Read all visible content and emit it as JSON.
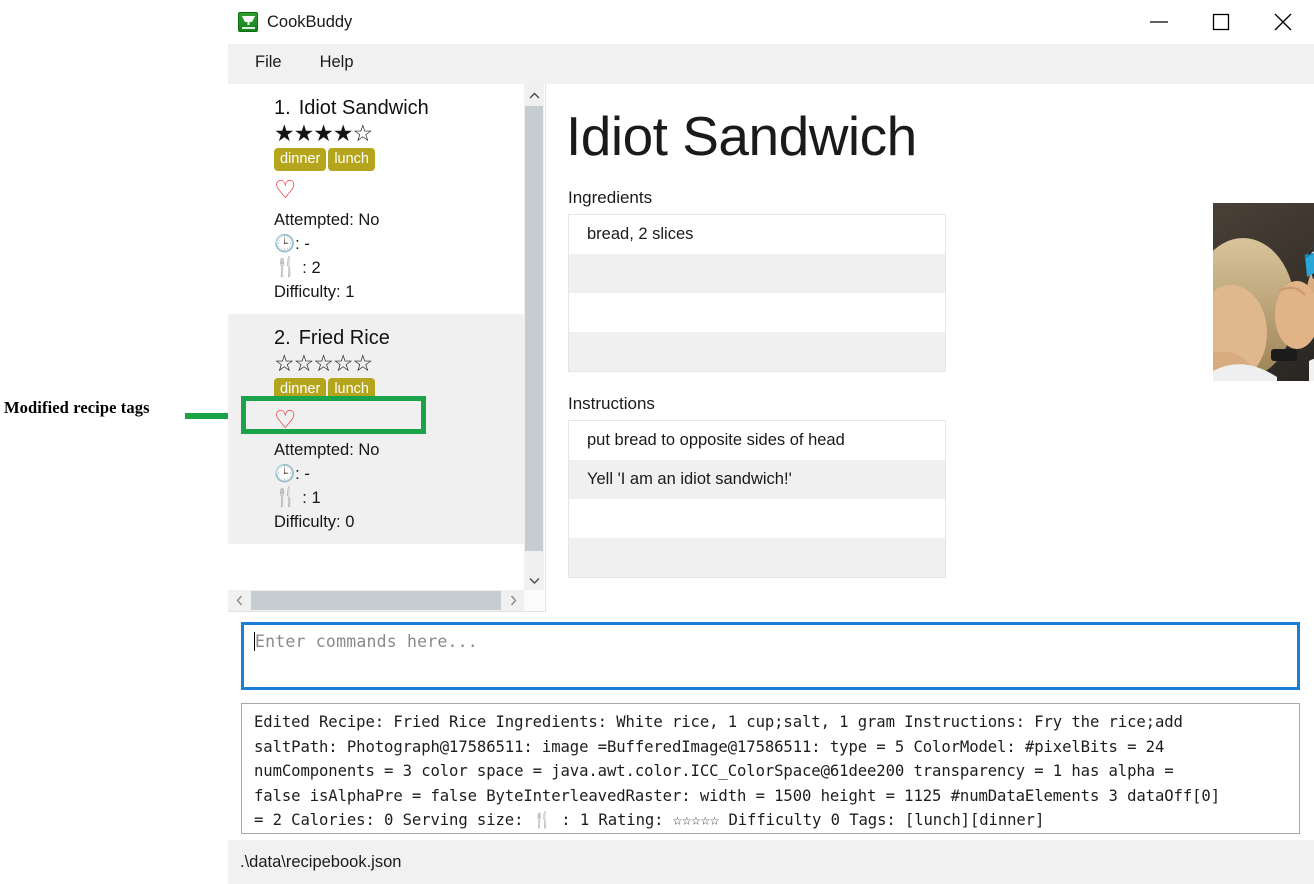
{
  "window": {
    "title": "CookBuddy",
    "icon": "cookbook-icon",
    "controls": {
      "minimize": "minimize-icon",
      "maximize": "maximize-icon",
      "close": "close-icon"
    }
  },
  "menubar": {
    "items": [
      {
        "label": "File"
      },
      {
        "label": "Help"
      }
    ]
  },
  "annotation": {
    "label": "Modified recipe tags",
    "color": "#1aa34a"
  },
  "recipe_list": {
    "items": [
      {
        "number": "1.",
        "name": "Idiot Sandwich",
        "stars": "★★★★☆",
        "rating": 4,
        "tags": [
          "dinner",
          "lunch"
        ],
        "favorite": "♡",
        "attempted_label": "Attempted: No",
        "time_icon": "clock-icon",
        "time_value": "-",
        "serving_icon": "cutlery-icon",
        "serving_value": "2",
        "difficulty_label": "Difficulty: 1"
      },
      {
        "number": "2.",
        "name": "Fried Rice",
        "stars": "☆☆☆☆☆",
        "rating": 0,
        "tags": [
          "dinner",
          "lunch"
        ],
        "favorite": "♡",
        "attempted_label": "Attempted: No",
        "time_icon": "clock-icon",
        "time_value": "-",
        "serving_icon": "cutlery-icon",
        "serving_value": "1",
        "difficulty_label": "Difficulty: 0"
      }
    ]
  },
  "detail": {
    "title": "Idiot Sandwich",
    "ingredients_label": "Ingredients",
    "ingredients": [
      "bread, 2 slices",
      "",
      "",
      ""
    ],
    "instructions_label": "Instructions",
    "instructions": [
      "put bread to opposite sides of head",
      "Yell 'I am an idiot sandwich!'",
      "",
      ""
    ],
    "photo_alt": "recipe-photo"
  },
  "command": {
    "value": "",
    "placeholder": "Enter commands here..."
  },
  "console": {
    "lines": [
      "Edited Recipe: Fried Rice Ingredients: White rice, 1 cup;salt, 1 gram Instructions: Fry the rice;add",
      "saltPath: Photograph@17586511: image =BufferedImage@17586511: type = 5 ColorModel: #pixelBits = 24",
      "numComponents = 3 color space = java.awt.color.ICC_ColorSpace@61dee200 transparency = 1 has alpha =",
      "false isAlphaPre = false ByteInterleavedRaster: width = 1500 height = 1125 #numDataElements 3 dataOff[0]",
      "= 2 Calories: 0 Serving size: ἷ4 : 1 Rating: ☆☆☆☆☆ Difficulty 0 Tags: [lunch][dinner]"
    ],
    "line5_parts": {
      "before": "= 2 Calories: 0 Serving size: ",
      "cutlery": "cutlery-icon",
      "after": " : 1 Rating: ☆☆☆☆☆ Difficulty 0 Tags: [lunch][dinner]"
    }
  },
  "statusbar": {
    "path": ".\\data\\recipebook.json"
  },
  "colors": {
    "tag": "#b5a51c",
    "heart": "#ee1d28",
    "focus_border": "#1a7fd4",
    "annotation": "#1aa34a"
  }
}
